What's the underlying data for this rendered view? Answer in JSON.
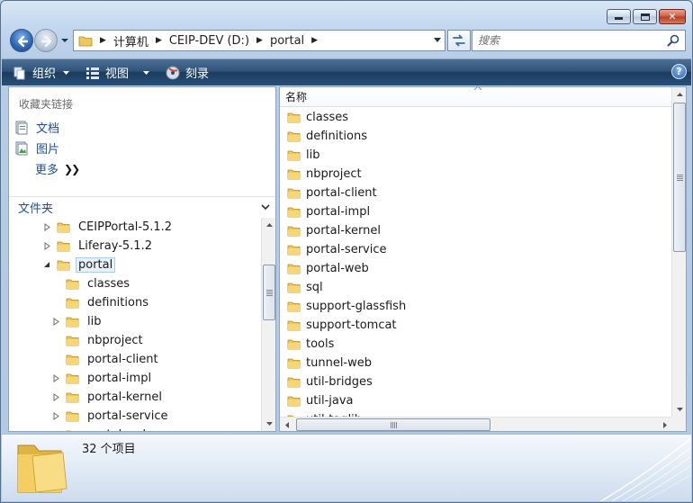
{
  "window": {
    "caption_buttons": [
      "minimize",
      "maximize",
      "close"
    ]
  },
  "navigation": {
    "breadcrumbs": [
      "计算机",
      "CEIP-DEV (D:)",
      "portal"
    ],
    "search_placeholder": "搜索"
  },
  "toolbar": {
    "organize_label": "组织",
    "views_label": "视图",
    "burn_label": "刻录",
    "help_label": "?"
  },
  "favorites": {
    "header": "收藏夹链接",
    "items": [
      {
        "label": "文档",
        "icon": "document-icon"
      },
      {
        "label": "图片",
        "icon": "picture-icon"
      },
      {
        "label": "更多",
        "icon": "more-chevrons-icon"
      }
    ]
  },
  "folders_pane": {
    "header": "文件夹",
    "tree": [
      {
        "label": "CEIPPortal-5.1.2",
        "expander": "collapsed",
        "indent": 0
      },
      {
        "label": "Liferay-5.1.2",
        "expander": "collapsed",
        "indent": 0
      },
      {
        "label": "portal",
        "expander": "expanded",
        "indent": 0,
        "selected": true
      },
      {
        "label": "classes",
        "expander": "none",
        "indent": 1
      },
      {
        "label": "definitions",
        "expander": "none",
        "indent": 1
      },
      {
        "label": "lib",
        "expander": "collapsed",
        "indent": 1
      },
      {
        "label": "nbproject",
        "expander": "none",
        "indent": 1
      },
      {
        "label": "portal-client",
        "expander": "none",
        "indent": 1
      },
      {
        "label": "portal-impl",
        "expander": "collapsed",
        "indent": 1
      },
      {
        "label": "portal-kernel",
        "expander": "collapsed",
        "indent": 1
      },
      {
        "label": "portal-service",
        "expander": "collapsed",
        "indent": 1
      },
      {
        "label": "portal-web",
        "expander": "collapsed",
        "indent": 1
      }
    ]
  },
  "file_list": {
    "column_name": "名称",
    "items": [
      "classes",
      "definitions",
      "lib",
      "nbproject",
      "portal-client",
      "portal-impl",
      "portal-kernel",
      "portal-service",
      "portal-web",
      "sql",
      "support-glassfish",
      "support-tomcat",
      "tools",
      "tunnel-web",
      "util-bridges",
      "util-java",
      "util-taglib"
    ]
  },
  "details": {
    "item_count": "32 个项目"
  },
  "colors": {
    "toolbar": "#27507a",
    "link_blue": "#1e4f9c",
    "selection": "#e6f1fb",
    "folder_yellow": "#f0c75a"
  }
}
